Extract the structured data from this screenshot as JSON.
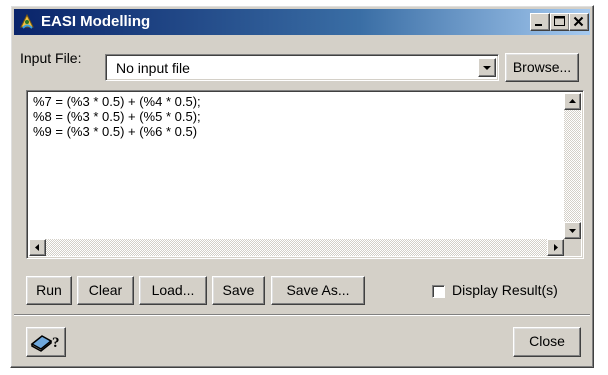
{
  "window": {
    "title": "EASI Modelling",
    "controls": {
      "minimize": "minimize",
      "maximize": "maximize",
      "close": "close"
    }
  },
  "input_file": {
    "label": "Input File:",
    "value": "No input file",
    "browse_label": "Browse..."
  },
  "editor": {
    "lines": [
      "%7 = (%3 * 0.5) + (%4 * 0.5);",
      "%8 = (%3 * 0.5) + (%5 * 0.5);",
      "%9 = (%3 * 0.5) + (%6 * 0.5)"
    ]
  },
  "toolbar": {
    "run_label": "Run",
    "clear_label": "Clear",
    "load_label": "Load...",
    "save_label": "Save",
    "save_as_label": "Save As...",
    "display_results_label": "Display Result(s)",
    "display_results_checked": false
  },
  "footer": {
    "help_icon": "help-book-icon",
    "close_label": "Close"
  },
  "colors": {
    "title_gradient_start": "#0a246a",
    "title_gradient_end": "#a6caf0",
    "face": "#d4d0c8"
  }
}
